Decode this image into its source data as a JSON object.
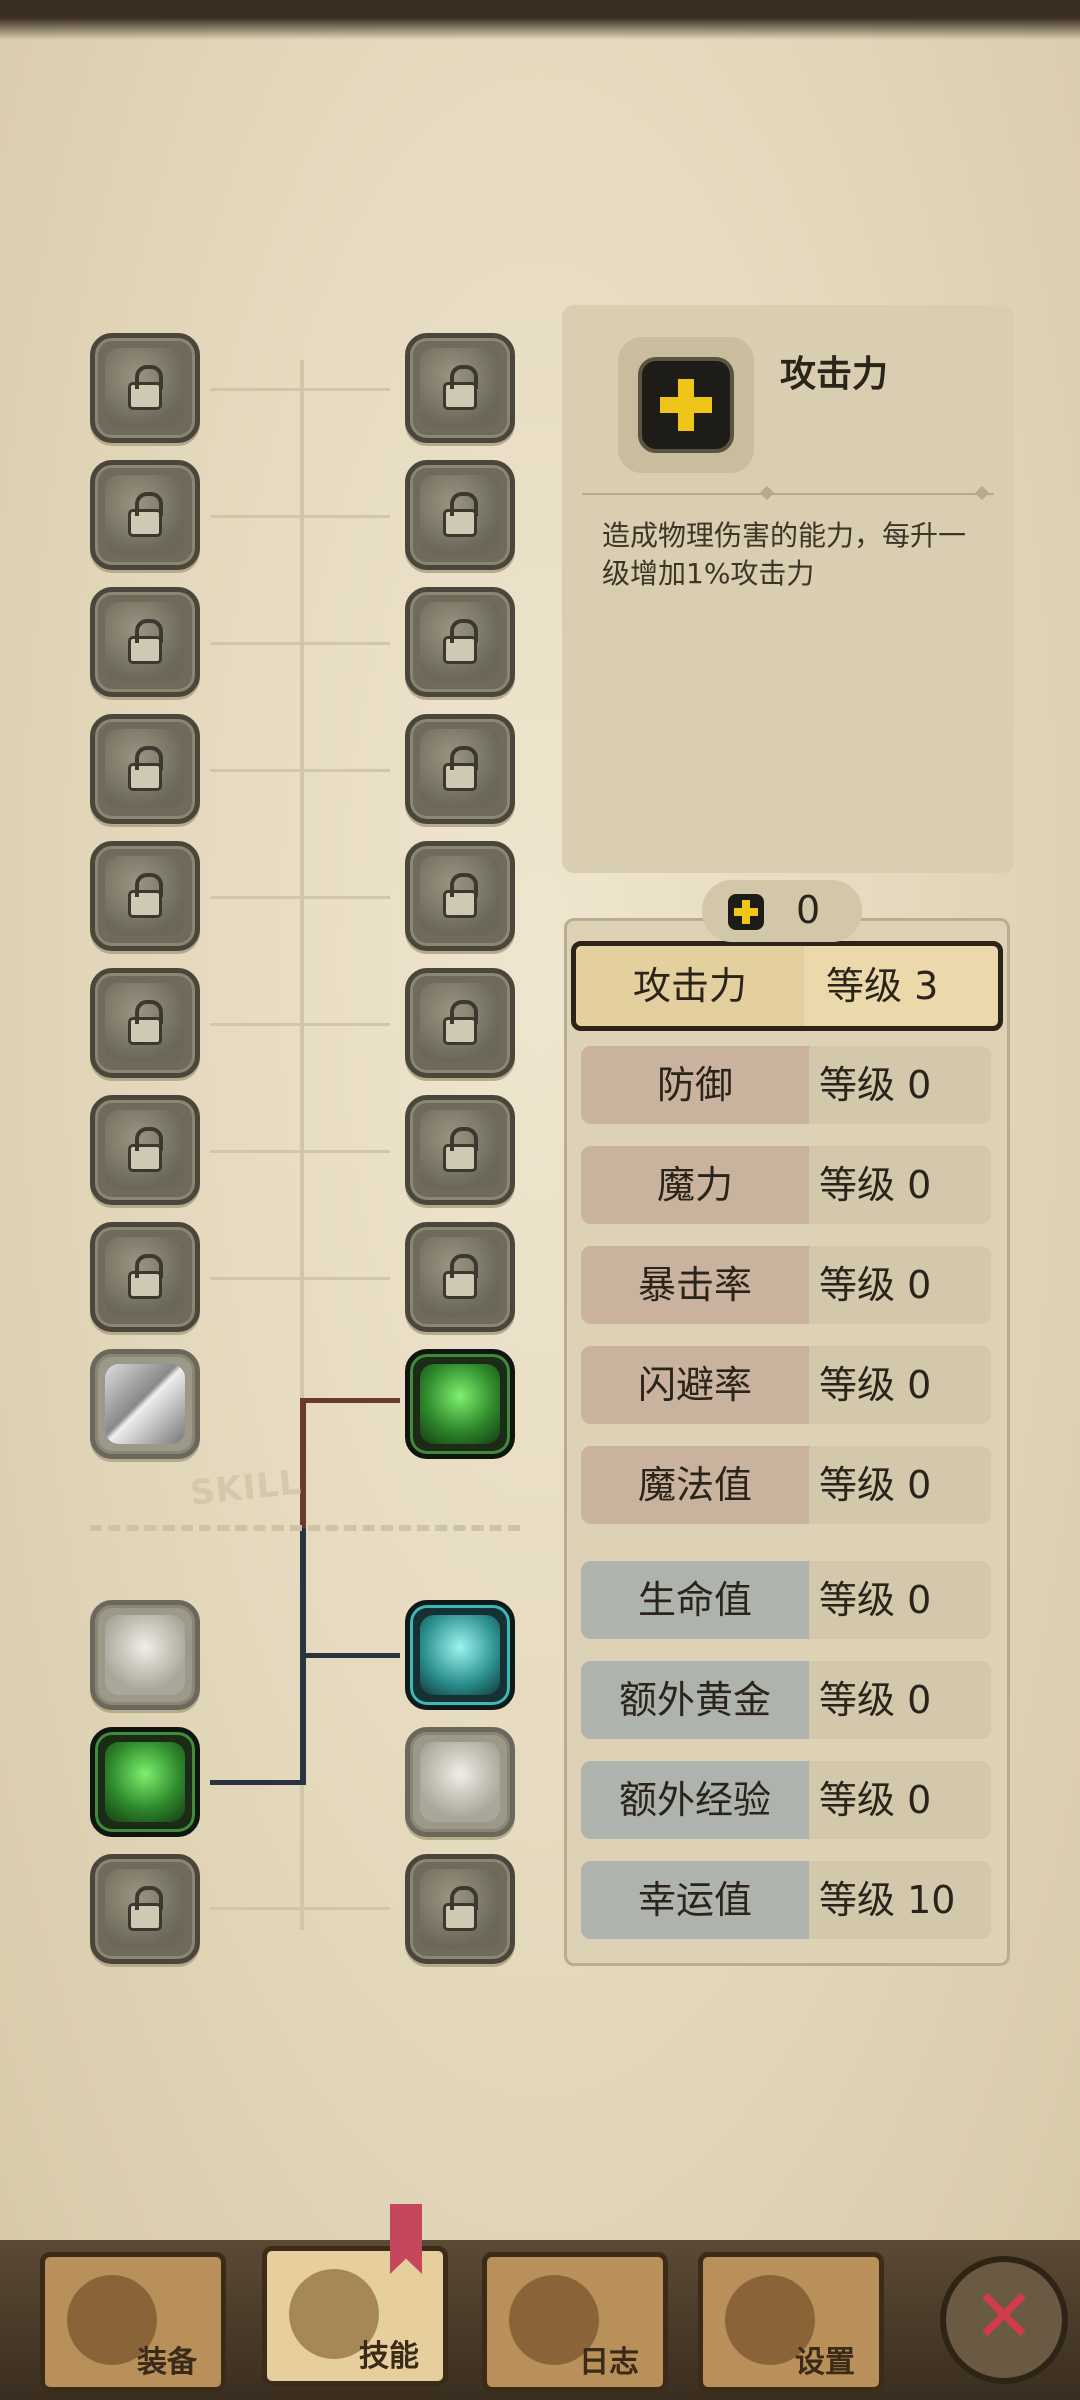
{
  "info": {
    "title": "攻击力",
    "description": "造成物理伤害的能力，每升一级增加1%攻击力",
    "icon": "plus-icon"
  },
  "points": {
    "value": "0"
  },
  "tree": {
    "skill_label": "SKILL"
  },
  "stats": [
    {
      "name": "攻击力",
      "level": "等级 3",
      "selected": true
    },
    {
      "name": "防御",
      "level": "等级 0"
    },
    {
      "name": "魔力",
      "level": "等级 0"
    },
    {
      "name": "暴击率",
      "level": "等级 0"
    },
    {
      "name": "闪避率",
      "level": "等级 0"
    },
    {
      "name": "魔法值",
      "level": "等级 0"
    },
    {
      "name": "生命值",
      "level": "等级 0"
    },
    {
      "name": "额外黄金",
      "level": "等级 0"
    },
    {
      "name": "额外经验",
      "level": "等级 0"
    },
    {
      "name": "幸运值",
      "level": "等级 10"
    }
  ],
  "nav": {
    "equip": "装备",
    "skills": "技能",
    "log": "日志",
    "settings": "设置"
  }
}
